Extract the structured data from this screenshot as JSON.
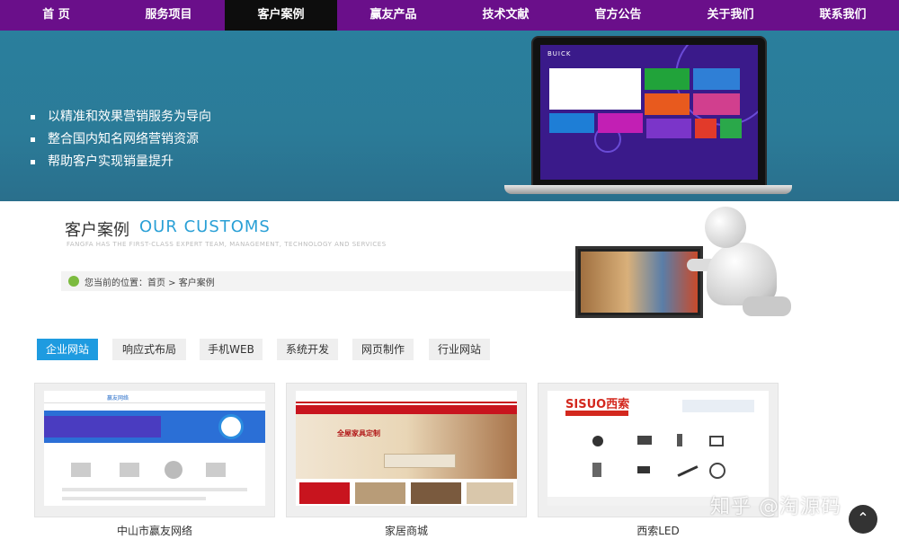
{
  "nav": {
    "items": [
      "首 页",
      "服务项目",
      "客户案例",
      "赢友产品",
      "技术文献",
      "官方公告",
      "关于我们",
      "联系我们"
    ],
    "active_index": 2
  },
  "banner": {
    "points": [
      "以精准和效果营销服务为导向",
      "整合国内知名网络营销资源",
      "帮助客户实现销量提升"
    ],
    "screen_logo": "BUICK"
  },
  "section": {
    "title_cn": "客户案例",
    "title_en": "OUR CUSTOMS",
    "subtitle": "FANGFA HAS THE FIRST-CLASS EXPERT TEAM, MANAGEMENT, TECHNOLOGY AND SERVICES"
  },
  "breadcrumb": {
    "text": "您当前的位置：首页 > 客户案例"
  },
  "tabs": {
    "items": [
      "企业网站",
      "响应式布局",
      "手机WEB",
      "系统开发",
      "网页制作",
      "行业网站"
    ],
    "active_index": 0
  },
  "cards": {
    "items": [
      {
        "label": "中山市赢友网络",
        "thumb_brand": "赢友网络"
      },
      {
        "label": "家居商城",
        "thumb_brand": "全屋家具定制"
      },
      {
        "label": "西索LED",
        "thumb_brand": "SISUO西索"
      }
    ]
  },
  "watermark": "知乎 @淘源码",
  "back_to_top_icon": "chevron-up-icon",
  "colors": {
    "nav_bg": "#6a0f8a",
    "nav_active": "#0d0d0d",
    "banner_bg": "#2a7f9d",
    "accent": "#1e9be0",
    "title_en": "#2aa0d6"
  }
}
